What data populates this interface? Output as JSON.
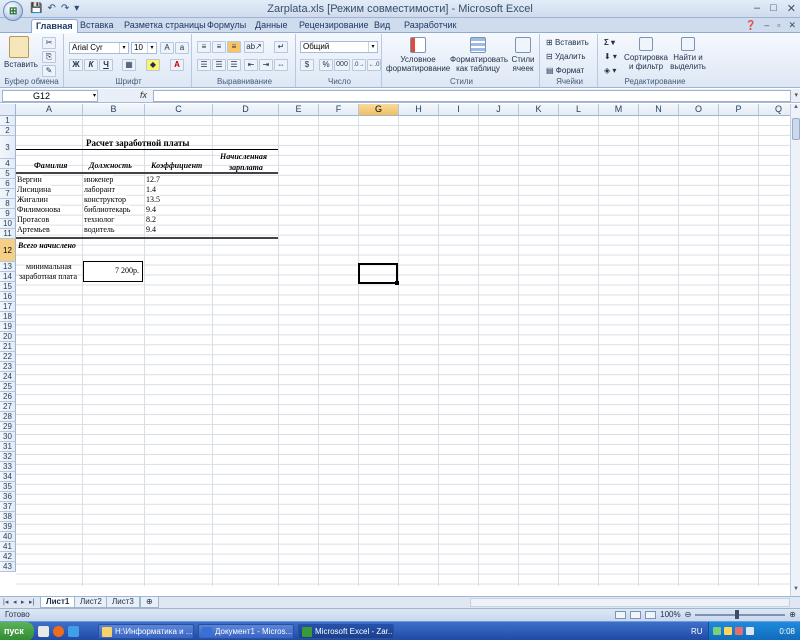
{
  "window": {
    "title": "Zarplata.xls  [Режим совместимости]  - Microsoft Excel",
    "controls": [
      "–",
      "□",
      "✕"
    ]
  },
  "qat": [
    "💾",
    "↶",
    "↷",
    "▾"
  ],
  "ribbon": {
    "tabs": [
      "Главная",
      "Вставка",
      "Разметка страницы",
      "Формулы",
      "Данные",
      "Рецензирование",
      "Вид",
      "Разработчик"
    ],
    "active_tab": "Главная",
    "groups": {
      "clipboard": {
        "label": "Буфер обмена",
        "paste": "Вставить"
      },
      "font": {
        "label": "Шрифт",
        "name": "Arial Cyr",
        "size": "10",
        "bold": "Ж",
        "italic": "К",
        "underline": "Ч"
      },
      "alignment": {
        "label": "Выравнивание"
      },
      "number": {
        "label": "Число",
        "format": "Общий",
        "percent": "%",
        "thousands": "000"
      },
      "styles": {
        "label": "Стили",
        "cond_line1": "Условное",
        "cond_line2": "форматирование",
        "table_line1": "Форматировать",
        "table_line2": "как таблицу",
        "cell_line1": "Стили",
        "cell_line2": "ячеек"
      },
      "cells": {
        "label": "Ячейки",
        "insert": "Вставить",
        "delete": "Удалить",
        "format": "Формат"
      },
      "editing": {
        "label": "Редактирование",
        "sort_line1": "Сортировка",
        "sort_line2": "и фильтр",
        "find_line1": "Найти и",
        "find_line2": "выделить"
      }
    }
  },
  "formula_bar": {
    "name_box": "G12",
    "fx": "fx",
    "content": ""
  },
  "grid": {
    "columns": [
      "A",
      "B",
      "C",
      "D",
      "E",
      "F",
      "G",
      "H",
      "I",
      "J",
      "K",
      "L",
      "M",
      "N",
      "O",
      "P",
      "Q"
    ],
    "selected_column": "G",
    "rows": [
      "1",
      "2",
      "3",
      "4",
      "5",
      "6",
      "7",
      "8",
      "9",
      "10",
      "11",
      "12",
      "13",
      "14",
      "15",
      "16",
      "17",
      "18",
      "19",
      "20",
      "21",
      "22",
      "23",
      "24",
      "25",
      "26",
      "27",
      "28",
      "29",
      "30",
      "31",
      "32",
      "33",
      "34",
      "35",
      "36",
      "37",
      "38",
      "39",
      "40",
      "41",
      "42",
      "43"
    ],
    "selected_row": "12",
    "selected_cell": "G12"
  },
  "sheet": {
    "title": "Расчет заработной платы",
    "headers": {
      "name": "Фамилия",
      "position": "Должность",
      "coef": "Коэффициент",
      "accrued_line1": "Начисленная",
      "accrued_line2": "зарплата"
    },
    "employees": [
      {
        "name": "Вергин",
        "position": "инженер",
        "coef": "12.7"
      },
      {
        "name": "Лисицина",
        "position": "лаборант",
        "coef": "1.4"
      },
      {
        "name": "Жигалин",
        "position": "конструктор",
        "coef": "13.5"
      },
      {
        "name": "Филимонова",
        "position": "библиотекарь",
        "coef": "9.4"
      },
      {
        "name": "Протасов",
        "position": "технолог",
        "coef": "8.2"
      },
      {
        "name": "Артемьев",
        "position": "водитель",
        "coef": "9.4"
      }
    ],
    "total_label": "Всего начислено",
    "min_wage_line1": "минимальная",
    "min_wage_line2": "заработная плата",
    "min_wage_value": "7 200р."
  },
  "sheet_tabs": [
    "Лист1",
    "Лист2",
    "Лист3"
  ],
  "active_sheet": "Лист1",
  "status": {
    "text": "Готово",
    "zoom": "100%"
  },
  "taskbar": {
    "start": "пуск",
    "tasks": [
      "Н:\\Информатика и ...",
      "Документ1 - Micros...",
      "Microsoft Excel - Zar..."
    ],
    "active_task": 2,
    "lang": "RU",
    "clock": "0:08"
  }
}
